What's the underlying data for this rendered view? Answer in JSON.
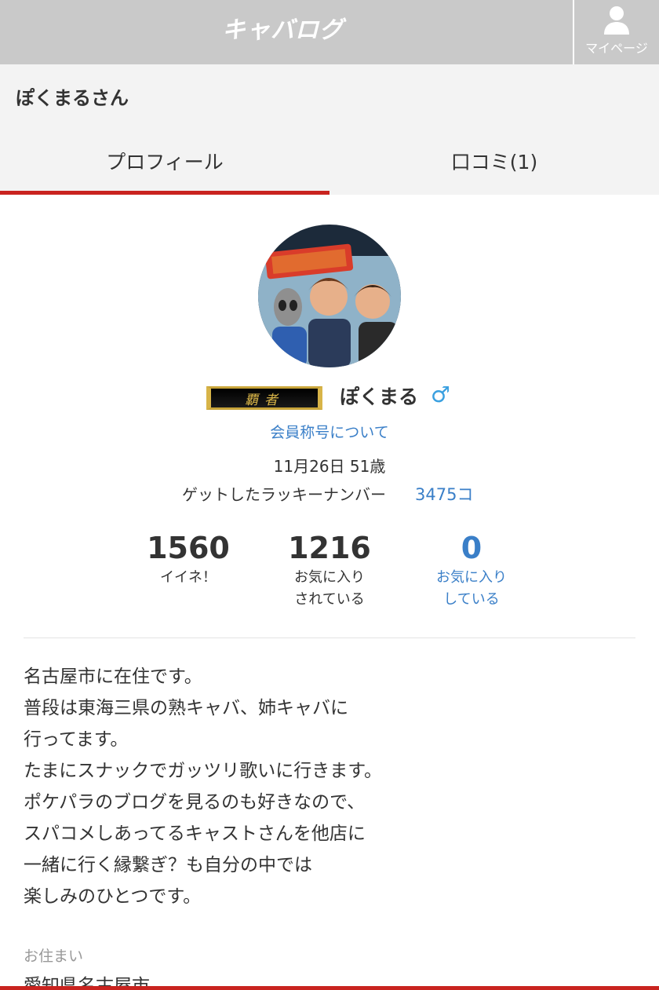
{
  "header": {
    "logo_text": "キャバログ",
    "mypage_label": "マイページ"
  },
  "page": {
    "title": "ぽくまるさん"
  },
  "tabs": [
    {
      "label": "プロフィール",
      "active": true
    },
    {
      "label": "口コミ(1)",
      "active": false
    }
  ],
  "profile": {
    "rank_title": "覇者",
    "username": "ぽくまる",
    "gender_symbol": "♂",
    "rank_link": "会員称号について",
    "birthday_age": "11月26日 51歳",
    "lucky_label": "ゲットしたラッキーナンバー",
    "lucky_value": "3475コ"
  },
  "stats": [
    {
      "value": "1560",
      "label_lines": [
        "イイネ！"
      ]
    },
    {
      "value": "1216",
      "label_lines": [
        "お気に入り",
        "されている"
      ]
    },
    {
      "value": "0",
      "label_lines": [
        "お気に入り",
        "している"
      ]
    }
  ],
  "bio_lines": [
    "名古屋市に在住です。",
    "普段は東海三県の熟キャバ、姉キャバに",
    "行ってます。",
    "たまにスナックでガッツリ歌いに行きます。",
    "ポケパラのブログを見るのも好きなので、",
    "スパコメしあってるキャストさんを他店に",
    "一緒に行く縁繋ぎ？も自分の中では",
    "楽しみのひとつです。"
  ],
  "residence": {
    "label": "お住まい",
    "value": "愛知県名古屋市"
  },
  "colors": {
    "accent_red": "#c9231f",
    "link_blue": "#3a7fc8",
    "header_gray": "#c9c9c9"
  }
}
